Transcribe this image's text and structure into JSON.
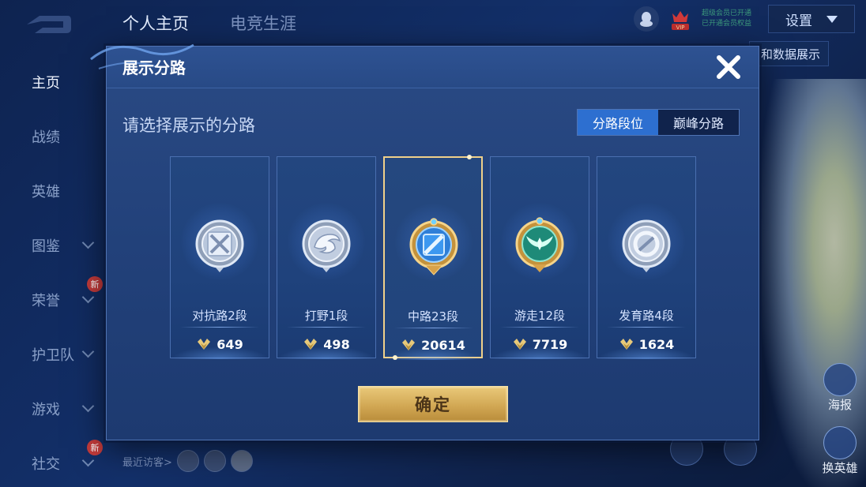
{
  "top_tabs": [
    {
      "label": "个人主页",
      "active": true
    },
    {
      "label": "电竞生涯",
      "active": false
    }
  ],
  "header_right": {
    "vip_lines": [
      "超级会员已开通",
      "已开通会员权益"
    ],
    "settings_label": "设置",
    "data_display_label": "和数据展示"
  },
  "sidebar": {
    "items": [
      {
        "label": "主页",
        "active": true,
        "chevron": false,
        "new_badge": ""
      },
      {
        "label": "战绩",
        "active": false,
        "chevron": false,
        "new_badge": ""
      },
      {
        "label": "英雄",
        "active": false,
        "chevron": false,
        "new_badge": ""
      },
      {
        "label": "图鉴",
        "active": false,
        "chevron": true,
        "new_badge": ""
      },
      {
        "label": "荣誉",
        "active": false,
        "chevron": true,
        "new_badge": "新"
      },
      {
        "label": "护卫队",
        "active": false,
        "chevron": true,
        "new_badge": ""
      },
      {
        "label": "游戏",
        "active": false,
        "chevron": true,
        "new_badge": ""
      },
      {
        "label": "社交",
        "active": false,
        "chevron": true,
        "new_badge": "新"
      }
    ]
  },
  "recent_visitors_label": "最近访客>",
  "right_buttons": {
    "poster_label": "海报",
    "switch_hero_label": "换英雄"
  },
  "modal": {
    "title": "展示分路",
    "prompt": "请选择展示的分路",
    "segments": [
      {
        "label": "分路段位",
        "active": true
      },
      {
        "label": "巅峰分路",
        "active": false
      }
    ],
    "lanes": [
      {
        "name": "对抗路2段",
        "score": "649",
        "icon": "clash-lane-emblem-icon",
        "selected": false
      },
      {
        "name": "打野1段",
        "score": "498",
        "icon": "jungle-dragon-emblem-icon",
        "selected": false
      },
      {
        "name": "中路23段",
        "score": "20614",
        "icon": "mid-lane-emblem-icon",
        "selected": true
      },
      {
        "name": "游走12段",
        "score": "7719",
        "icon": "roam-wings-emblem-icon",
        "selected": false
      },
      {
        "name": "发育路4段",
        "score": "1624",
        "icon": "farm-lane-emblem-icon",
        "selected": false
      }
    ],
    "confirm_label": "确定"
  },
  "colors": {
    "background": "#13306a",
    "modal_panel": "#22417a",
    "segment_active": "#2d6fd0",
    "selected_card_border": "#f0d08a",
    "confirm_gold": "#d2a854"
  }
}
